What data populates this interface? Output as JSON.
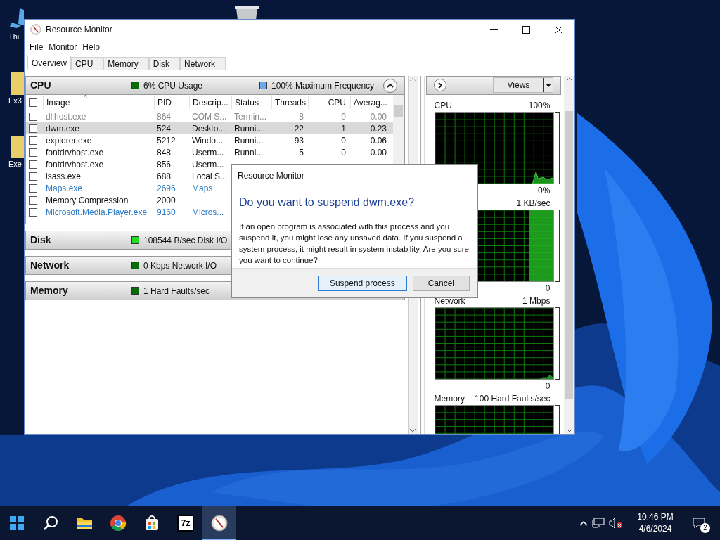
{
  "desktop": {
    "icons": [
      {
        "label": "Thi"
      },
      {
        "label": "Ex3"
      },
      {
        "label": "Exe"
      }
    ]
  },
  "window": {
    "title": "Resource Monitor",
    "menu": [
      "File",
      "Monitor",
      "Help"
    ],
    "tabs": [
      {
        "label": "Overview",
        "selected": true
      },
      {
        "label": "CPU",
        "selected": false
      },
      {
        "label": "Memory",
        "selected": false
      },
      {
        "label": "Disk",
        "selected": false
      },
      {
        "label": "Network",
        "selected": false
      }
    ],
    "sections": [
      {
        "title": "CPU",
        "expanded": true,
        "stats": [
          {
            "text": "6% CPU Usage",
            "color": "#0a6b0a"
          },
          {
            "text": "100% Maximum Frequency",
            "color": "#6aa8e8"
          }
        ],
        "table": {
          "sort_mark": "^",
          "all_checked": false,
          "columns": [
            "Image",
            "PID",
            "Descrip...",
            "Status",
            "Threads",
            "CPU",
            "Averag..."
          ],
          "rows": [
            {
              "kind": "terminated",
              "selected": false,
              "checked": false,
              "cells": [
                "dllhost.exe",
                "864",
                "COM S...",
                "Termin...",
                "8",
                "0",
                "0.00"
              ]
            },
            {
              "kind": "normal",
              "selected": true,
              "checked": false,
              "cells": [
                "dwm.exe",
                "524",
                "Deskto...",
                "Runni...",
                "22",
                "1",
                "0.23"
              ]
            },
            {
              "kind": "normal",
              "selected": false,
              "checked": false,
              "cells": [
                "explorer.exe",
                "5212",
                "Windo...",
                "Runni...",
                "93",
                "0",
                "0.06"
              ]
            },
            {
              "kind": "normal",
              "selected": false,
              "checked": false,
              "cells": [
                "fontdrvhost.exe",
                "848",
                "Userm...",
                "Runni...",
                "5",
                "0",
                "0.00"
              ]
            },
            {
              "kind": "normal",
              "selected": false,
              "checked": false,
              "cells": [
                "fontdrvhost.exe",
                "856",
                "Userm..."
              ]
            },
            {
              "kind": "normal",
              "selected": false,
              "checked": false,
              "cells": [
                "lsass.exe",
                "688",
                "Local S..."
              ]
            },
            {
              "kind": "app",
              "selected": false,
              "checked": false,
              "cells": [
                "Maps.exe",
                "2696",
                "Maps"
              ]
            },
            {
              "kind": "normal",
              "selected": false,
              "checked": false,
              "cells": [
                "Memory Compression",
                "2000",
                ""
              ]
            },
            {
              "kind": "app",
              "selected": false,
              "checked": false,
              "cells": [
                "Microsoft.Media.Player.exe",
                "9160",
                "Micros..."
              ]
            }
          ]
        }
      },
      {
        "title": "Disk",
        "expanded": false,
        "stats": [
          {
            "text": "108544 B/sec Disk I/O",
            "color": "#22dd22"
          }
        ]
      },
      {
        "title": "Network",
        "expanded": false,
        "stats": [
          {
            "text": "0 Kbps Network I/O",
            "color": "#0a6b0a"
          }
        ]
      },
      {
        "title": "Memory",
        "expanded": false,
        "stats": [
          {
            "text": "1 Hard Faults/sec",
            "color": "#0a6b0a"
          }
        ]
      }
    ],
    "views_button": "Views",
    "graphs": [
      {
        "kind": "cpu",
        "label": "CPU",
        "max": "100%",
        "min": "0%"
      },
      {
        "kind": "disk",
        "max": "1 KB/sec",
        "min": "0"
      },
      {
        "kind": "network",
        "label": "Network",
        "max": "1 Mbps",
        "min": "0"
      },
      {
        "kind": "memory",
        "label": "Memory",
        "max": "100 Hard Faults/sec"
      }
    ]
  },
  "dialog": {
    "title": "Resource Monitor",
    "heading": "Do you want to suspend dwm.exe?",
    "message": "If an open program is associated with this process and you suspend it, you might lose any unsaved data. If you suspend a system process, it might result in system instability. Are you sure you want to continue?",
    "buttons": [
      {
        "label": "Suspend process",
        "default": true
      },
      {
        "label": "Cancel",
        "default": false
      }
    ]
  },
  "taskbar": {
    "apps": [
      {
        "kind": "explorer",
        "active": false
      },
      {
        "kind": "chrome",
        "active": false
      },
      {
        "kind": "store",
        "active": false
      },
      {
        "kind": "zip",
        "label": "7z",
        "active": false
      },
      {
        "kind": "resmon",
        "active": true
      }
    ],
    "time": "10:46 PM",
    "date": "4/6/2024",
    "notifications": "2"
  }
}
